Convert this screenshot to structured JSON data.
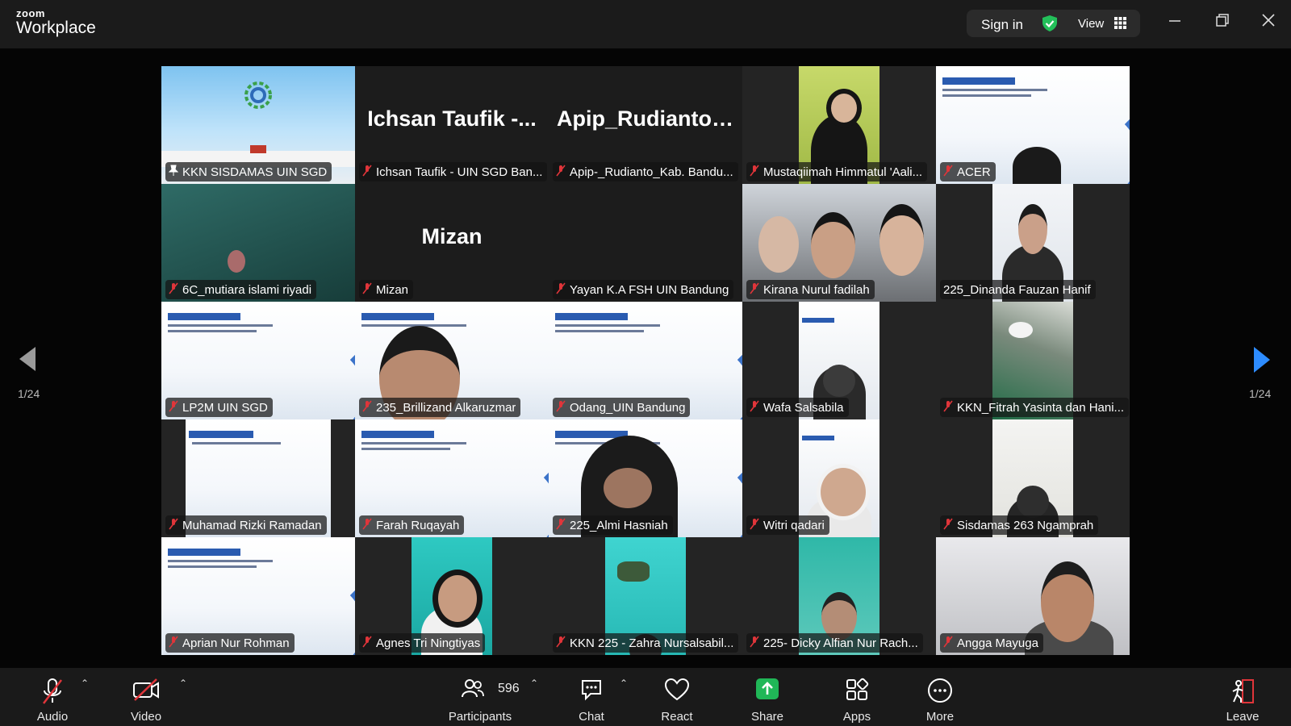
{
  "titlebar": {
    "logo_small": "zoom",
    "logo_big": "Workplace",
    "sign_in": "Sign in",
    "view": "View"
  },
  "nav": {
    "left_page": "1/24",
    "right_page": "1/24"
  },
  "tiles": [
    {
      "name": "KKN SISDAMAS UIN SGD",
      "big": ""
    },
    {
      "name": "Ichsan Taufik - UIN SGD Ban...",
      "big": "Ichsan Taufik -..."
    },
    {
      "name": "Apip-_Rudianto_Kab. Bandu...",
      "big": "Apip_Rudianto_..."
    },
    {
      "name": "Mustaqiimah Himmatul 'Aali...",
      "big": ""
    },
    {
      "name": "ACER",
      "big": ""
    },
    {
      "name": "6C_mutiara islami riyadi",
      "big": ""
    },
    {
      "name": "Mizan",
      "big": "Mizan"
    },
    {
      "name": "Yayan K.A FSH UIN Bandung",
      "big": ""
    },
    {
      "name": "Kirana Nurul fadilah",
      "big": ""
    },
    {
      "name": "225_Dinanda Fauzan Hanif",
      "big": ""
    },
    {
      "name": "LP2M UIN SGD",
      "big": ""
    },
    {
      "name": "235_Brillizand Alkaruzmar",
      "big": ""
    },
    {
      "name": "Odang_UIN Bandung",
      "big": ""
    },
    {
      "name": "Wafa Salsabila",
      "big": ""
    },
    {
      "name": "KKN_Fitrah Yasinta dan Hani...",
      "big": ""
    },
    {
      "name": "Muhamad Rizki Ramadan",
      "big": ""
    },
    {
      "name": "Farah Ruqayah",
      "big": ""
    },
    {
      "name": "225_Almi Hasniah",
      "big": ""
    },
    {
      "name": "Witri qadari",
      "big": ""
    },
    {
      "name": "Sisdamas 263 Ngamprah",
      "big": ""
    },
    {
      "name": "Aprian Nur Rohman",
      "big": ""
    },
    {
      "name": "Agnes Tri Ningtiyas",
      "big": ""
    },
    {
      "name": "KKN 225 - Zahra Nursalsabil...",
      "big": ""
    },
    {
      "name": "225- Dicky Alfian Nur Rach...",
      "big": ""
    },
    {
      "name": "Angga Mayuga",
      "big": ""
    }
  ],
  "toolbar": {
    "audio": "Audio",
    "video": "Video",
    "participants": "Participants",
    "participant_count": "596",
    "chat": "Chat",
    "react": "React",
    "share": "Share",
    "apps": "Apps",
    "more": "More",
    "leave": "Leave"
  },
  "colors": {
    "active_speaker": "#2bd560",
    "muted_icon": "#e0353a",
    "nav_arrow": "#2d8cff",
    "share_green": "#20b757"
  }
}
